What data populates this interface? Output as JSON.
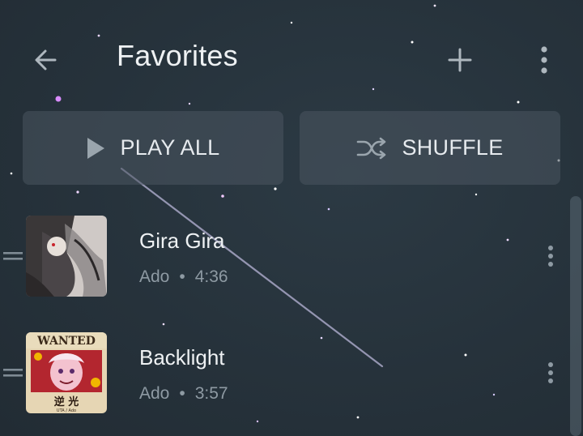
{
  "header": {
    "title": "Favorites",
    "back_icon": "back-arrow-icon",
    "add_icon": "plus-icon",
    "menu_icon": "more-vert-icon"
  },
  "actions": {
    "play_all_label": "PLAY ALL",
    "play_icon": "play-icon",
    "shuffle_label": "SHUFFLE",
    "shuffle_icon": "shuffle-icon"
  },
  "tracks": [
    {
      "title": "Gira Gira",
      "artist": "Ado",
      "separator": "•",
      "duration": "4:36",
      "menu_icon": "more-vert-icon"
    },
    {
      "title": "Backlight",
      "artist": "Ado",
      "separator": "•",
      "duration": "3:57",
      "menu_icon": "more-vert-icon"
    }
  ],
  "colors": {
    "background": "#26323b",
    "button_bg": "#4a5660",
    "text_primary": "#eef1f3",
    "text_secondary": "#8e9aa3"
  }
}
